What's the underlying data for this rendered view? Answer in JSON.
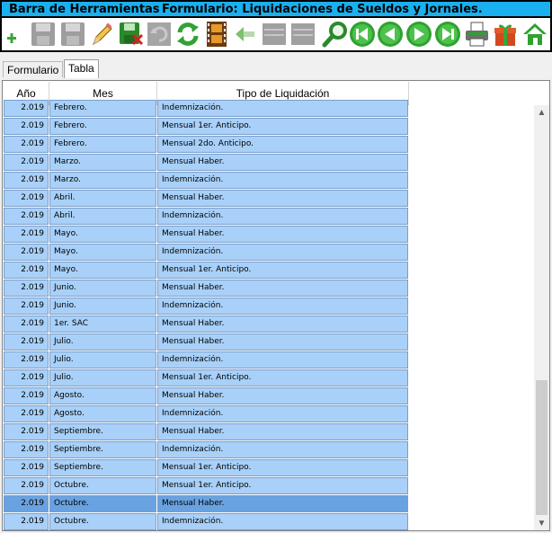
{
  "titlebar": {
    "left": "Barra de Herramientas",
    "right": "Formulario: Liquidaciones de Sueldos y Jornales."
  },
  "toolbar": {
    "buttons": [
      {
        "icon": "add-icon"
      },
      {
        "icon": "save-icon"
      },
      {
        "icon": "save-as-icon"
      },
      {
        "icon": "edit-pencil-icon"
      },
      {
        "icon": "delete-save-icon"
      },
      {
        "icon": "undo-icon"
      },
      {
        "icon": "refresh-icon"
      },
      {
        "icon": "film-icon"
      },
      {
        "icon": "enter-icon"
      },
      {
        "icon": "disabled-icon"
      },
      {
        "icon": "disabled-icon"
      },
      {
        "icon": "search-icon"
      },
      {
        "icon": "first-record-icon"
      },
      {
        "icon": "previous-record-icon"
      },
      {
        "icon": "next-record-icon"
      },
      {
        "icon": "last-record-icon"
      },
      {
        "icon": "print-icon"
      },
      {
        "icon": "gift-icon"
      },
      {
        "icon": "home-icon"
      }
    ]
  },
  "tabs": [
    {
      "label": "Formulario"
    },
    {
      "label": "Tabla"
    }
  ],
  "grid": {
    "columns": [
      "Año",
      "Mes",
      "Tipo de Liquidación"
    ],
    "rows": [
      {
        "anio": "2.019",
        "mes": "Febrero.",
        "tipo": "Indemnización."
      },
      {
        "anio": "2.019",
        "mes": "Febrero.",
        "tipo": "Mensual 1er. Anticipo."
      },
      {
        "anio": "2.019",
        "mes": "Febrero.",
        "tipo": "Mensual 2do. Anticipo."
      },
      {
        "anio": "2.019",
        "mes": "Marzo.",
        "tipo": "Mensual Haber."
      },
      {
        "anio": "2.019",
        "mes": "Marzo.",
        "tipo": "Indemnización."
      },
      {
        "anio": "2.019",
        "mes": "Abril.",
        "tipo": "Mensual Haber."
      },
      {
        "anio": "2.019",
        "mes": "Abril.",
        "tipo": "Indemnización."
      },
      {
        "anio": "2.019",
        "mes": "Mayo.",
        "tipo": "Mensual Haber."
      },
      {
        "anio": "2.019",
        "mes": "Mayo.",
        "tipo": "Indemnización."
      },
      {
        "anio": "2.019",
        "mes": "Mayo.",
        "tipo": "Mensual 1er. Anticipo."
      },
      {
        "anio": "2.019",
        "mes": "Junio.",
        "tipo": "Mensual Haber."
      },
      {
        "anio": "2.019",
        "mes": "Junio.",
        "tipo": "Indemnización."
      },
      {
        "anio": "2.019",
        "mes": "1er. SAC",
        "tipo": "Mensual Haber."
      },
      {
        "anio": "2.019",
        "mes": "Julio.",
        "tipo": "Mensual Haber."
      },
      {
        "anio": "2.019",
        "mes": "Julio.",
        "tipo": "Indemnización."
      },
      {
        "anio": "2.019",
        "mes": "Julio.",
        "tipo": "Mensual 1er. Anticipo."
      },
      {
        "anio": "2.019",
        "mes": "Agosto.",
        "tipo": "Mensual Haber."
      },
      {
        "anio": "2.019",
        "mes": "Agosto.",
        "tipo": "Indemnización."
      },
      {
        "anio": "2.019",
        "mes": "Septiembre.",
        "tipo": "Mensual Haber."
      },
      {
        "anio": "2.019",
        "mes": "Septiembre.",
        "tipo": "Indemnización."
      },
      {
        "anio": "2.019",
        "mes": "Septiembre.",
        "tipo": "Mensual 1er. Anticipo."
      },
      {
        "anio": "2.019",
        "mes": "Octubre.",
        "tipo": "Mensual 1er. Anticipo."
      },
      {
        "anio": "2.019",
        "mes": "Octubre.",
        "tipo": "Mensual Haber.",
        "selected": true
      },
      {
        "anio": "2.019",
        "mes": "Octubre.",
        "tipo": "Indemnización."
      }
    ]
  },
  "colors": {
    "title_bg": "#1ab0ef",
    "cell_bg": "#a8d0f8",
    "selected_bg": "#69a2e0"
  }
}
